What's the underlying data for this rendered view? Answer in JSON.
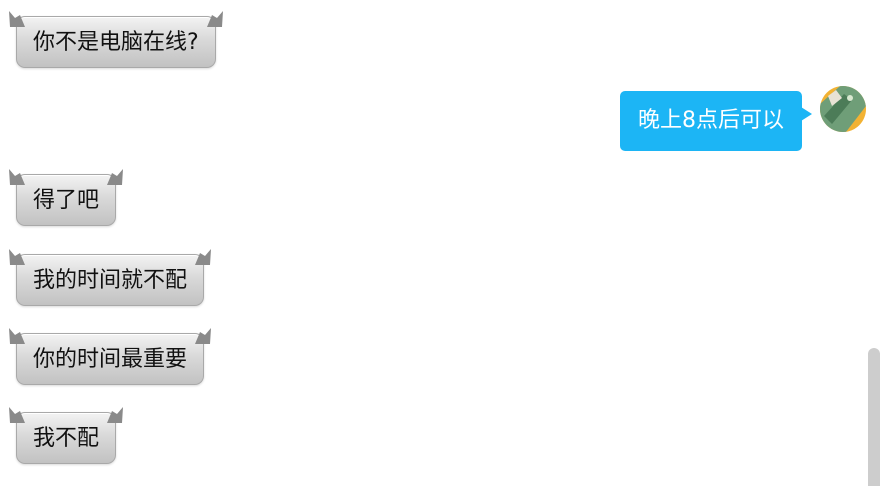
{
  "messages": [
    {
      "side": "in",
      "text": "你不是电脑在线?"
    },
    {
      "side": "out",
      "text": "晚上8点后可以"
    },
    {
      "side": "in",
      "text": "得了吧"
    },
    {
      "side": "in",
      "text": "我的时间就不配"
    },
    {
      "side": "in",
      "text": "你的时间最重要"
    },
    {
      "side": "in",
      "text": "我不配"
    }
  ],
  "colors": {
    "outgoing_bubble": "#1cb5f5",
    "incoming_text": "#111111",
    "outgoing_text": "#ffffff"
  }
}
